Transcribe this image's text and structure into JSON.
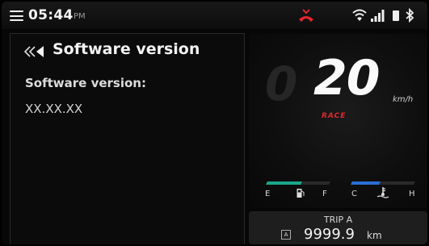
{
  "status_bar": {
    "time": "05:44",
    "ampm": "PM",
    "icons": [
      "menu-icon",
      "missed-call-icon",
      "wifi-icon",
      "signal-icon",
      "battery-icon",
      "bluetooth-icon"
    ],
    "call_icon_color": "#e3262c"
  },
  "panel": {
    "title": "Software version",
    "label": "Software version:",
    "value": "XX.XX.XX"
  },
  "dashboard": {
    "speed": "20",
    "ghost_digit": "0",
    "speed_unit": "km/h",
    "mode": "RACE",
    "mode_color": "#e3262c",
    "fuel_gauge": {
      "empty_label": "E",
      "full_label": "F",
      "level_fraction": 0.55,
      "color": "#1aa78a"
    },
    "temp_gauge": {
      "cold_label": "C",
      "hot_label": "H",
      "level_fraction": 0.45,
      "color": "#2a6fd6"
    }
  },
  "trip": {
    "label": "TRIP A",
    "badge": "A",
    "value": "9999.9",
    "unit": "km"
  }
}
